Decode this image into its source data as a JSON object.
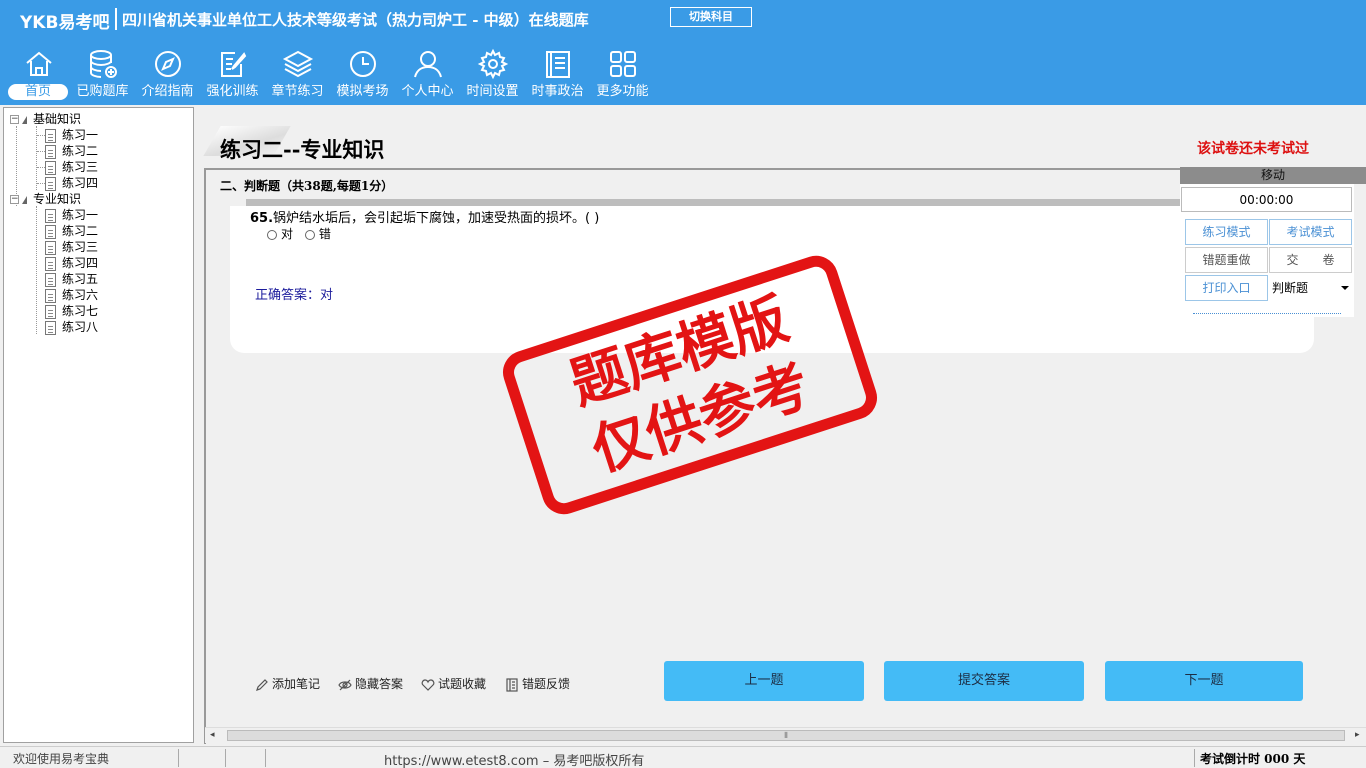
{
  "header": {
    "logo": "YKB易考吧",
    "title": "四川省机关事业单位工人技术等级考试（热力司炉工 - 中级）在线题库",
    "switch_label": "切换科目"
  },
  "nav": [
    {
      "label": "首页",
      "icon": "home-icon"
    },
    {
      "label": "已购题库",
      "icon": "database-icon"
    },
    {
      "label": "介绍指南",
      "icon": "compass-icon"
    },
    {
      "label": "强化训练",
      "icon": "edit-icon"
    },
    {
      "label": "章节练习",
      "icon": "layers-icon"
    },
    {
      "label": "模拟考场",
      "icon": "clock-icon"
    },
    {
      "label": "个人中心",
      "icon": "user-icon"
    },
    {
      "label": "时间设置",
      "icon": "gear-icon"
    },
    {
      "label": "时事政治",
      "icon": "news-icon"
    },
    {
      "label": "更多功能",
      "icon": "grid-icon"
    }
  ],
  "tree": {
    "groups": [
      {
        "label": "基础知识",
        "items": [
          "练习一",
          "练习二",
          "练习三",
          "练习四"
        ]
      },
      {
        "label": "专业知识",
        "items": [
          "练习一",
          "练习二",
          "练习三",
          "练习四",
          "练习五",
          "练习六",
          "练习七",
          "练习八"
        ]
      }
    ]
  },
  "main": {
    "section_title": "练习二--专业知识",
    "status_notice": "该试卷还未考试过",
    "question_type": "二、判断题（共38题,每题1分）",
    "question_number": "65.",
    "question_text": "锅炉结水垢后，会引起垢下腐蚀，加速受热面的损坏。( )",
    "options": [
      "对",
      "错"
    ],
    "answer": "正确答案：对",
    "stamp_line1": "题库模版",
    "stamp_line2": "仅供参考"
  },
  "panel": {
    "move_label": "移动",
    "timer": "00:00:00",
    "practice_mode": "练习模式",
    "exam_mode": "考试模式",
    "redo_wrong": "错题重做",
    "submit_paper": "交　　卷",
    "print_entry": "打印入口",
    "type_select": "判断题"
  },
  "tools": {
    "add_note": "添加笔记",
    "hide_answer": "隐藏答案",
    "favorite": "试题收藏",
    "feedback": "错题反馈"
  },
  "buttons": {
    "prev": "上一题",
    "submit": "提交答案",
    "next": "下一题"
  },
  "status": {
    "welcome": "欢迎使用易考宝典",
    "copyright": "https://www.etest8.com – 易考吧版权所有",
    "countdown": "考试倒计时 000 天"
  },
  "colors": {
    "header_bg": "#3a9be6",
    "button_bg": "#44bbf6",
    "stamp_red": "#e31414",
    "notice_red": "#d11111",
    "answer_blue": "#1c1c9c"
  }
}
